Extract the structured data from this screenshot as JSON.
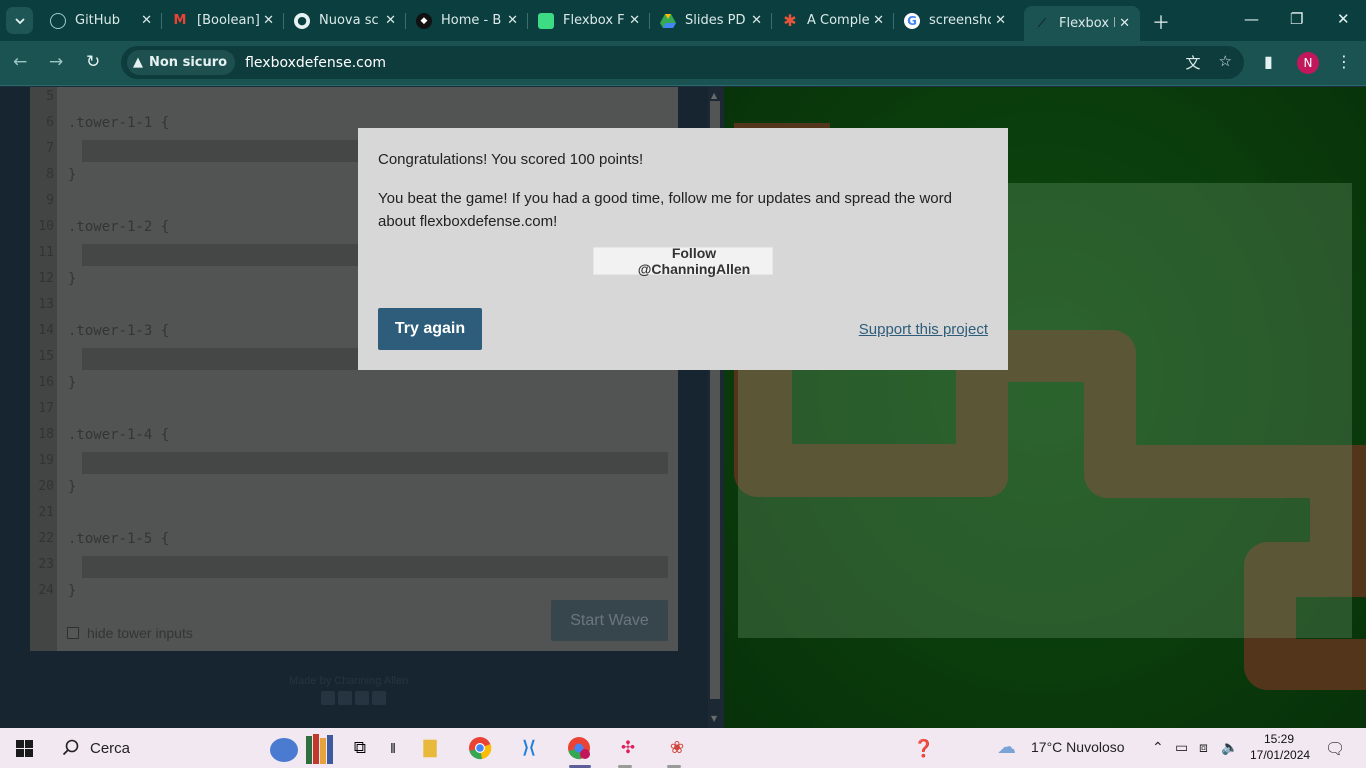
{
  "browser": {
    "tabs": [
      {
        "title": "GitHub",
        "icon": "github-icon"
      },
      {
        "title": "[Boolean]",
        "icon": "gmail-icon"
      },
      {
        "title": "Nuova sc",
        "icon": "chrome-icon"
      },
      {
        "title": "Home - B",
        "icon": "boolean-icon"
      },
      {
        "title": "Flexbox F",
        "icon": "android-icon"
      },
      {
        "title": "Slides PD",
        "icon": "google-drive-icon"
      },
      {
        "title": "A Comple",
        "icon": "asterisk-icon"
      },
      {
        "title": "screensho",
        "icon": "google-icon"
      },
      {
        "title": "Flexbox D",
        "icon": "flexbox-defense-icon",
        "active": true
      }
    ],
    "security_label": "Non sicuro",
    "url": "flexboxdefense.com",
    "profile_initial": "N"
  },
  "editor": {
    "lines": [
      {
        "n": "5",
        "text": ""
      },
      {
        "n": "6",
        "text": ".tower-1-1 {"
      },
      {
        "n": "7",
        "text": ""
      },
      {
        "n": "8",
        "text": "}"
      },
      {
        "n": "9",
        "text": ""
      },
      {
        "n": "10",
        "text": ".tower-1-2 {"
      },
      {
        "n": "11",
        "text": ""
      },
      {
        "n": "12",
        "text": "}"
      },
      {
        "n": "13",
        "text": ""
      },
      {
        "n": "14",
        "text": ".tower-1-3 {"
      },
      {
        "n": "15",
        "text": ""
      },
      {
        "n": "16",
        "text": "}"
      },
      {
        "n": "17",
        "text": ""
      },
      {
        "n": "18",
        "text": ".tower-1-4 {"
      },
      {
        "n": "19",
        "text": ""
      },
      {
        "n": "20",
        "text": "}"
      },
      {
        "n": "21",
        "text": ""
      },
      {
        "n": "22",
        "text": ".tower-1-5 {"
      },
      {
        "n": "23",
        "text": ""
      },
      {
        "n": "24",
        "text": "}"
      }
    ],
    "start_wave_label": "Start Wave",
    "hide_inputs_label": "hide tower inputs",
    "credits": "Made by Channing Allen"
  },
  "modal": {
    "congrats": "Congratulations! You scored 100 points!",
    "message": "You beat the game! If you had a good time, follow me for updates and spread the word about flexboxdefense.com!",
    "follow_label": "Follow @ChanningAllen",
    "try_again_label": "Try again",
    "support_label": "Support this project"
  },
  "taskbar": {
    "search_placeholder": "Cerca",
    "weather": "17°C  Nuvoloso",
    "time": "15:29",
    "date": "17/01/2024"
  },
  "colors": {
    "tab_bar": "#0b3f3f",
    "toolbar": "#1b5353",
    "board_green": "#0a5c0a",
    "path_brown": "#6b3f1c",
    "try_again_blue": "#2d5d7b"
  }
}
